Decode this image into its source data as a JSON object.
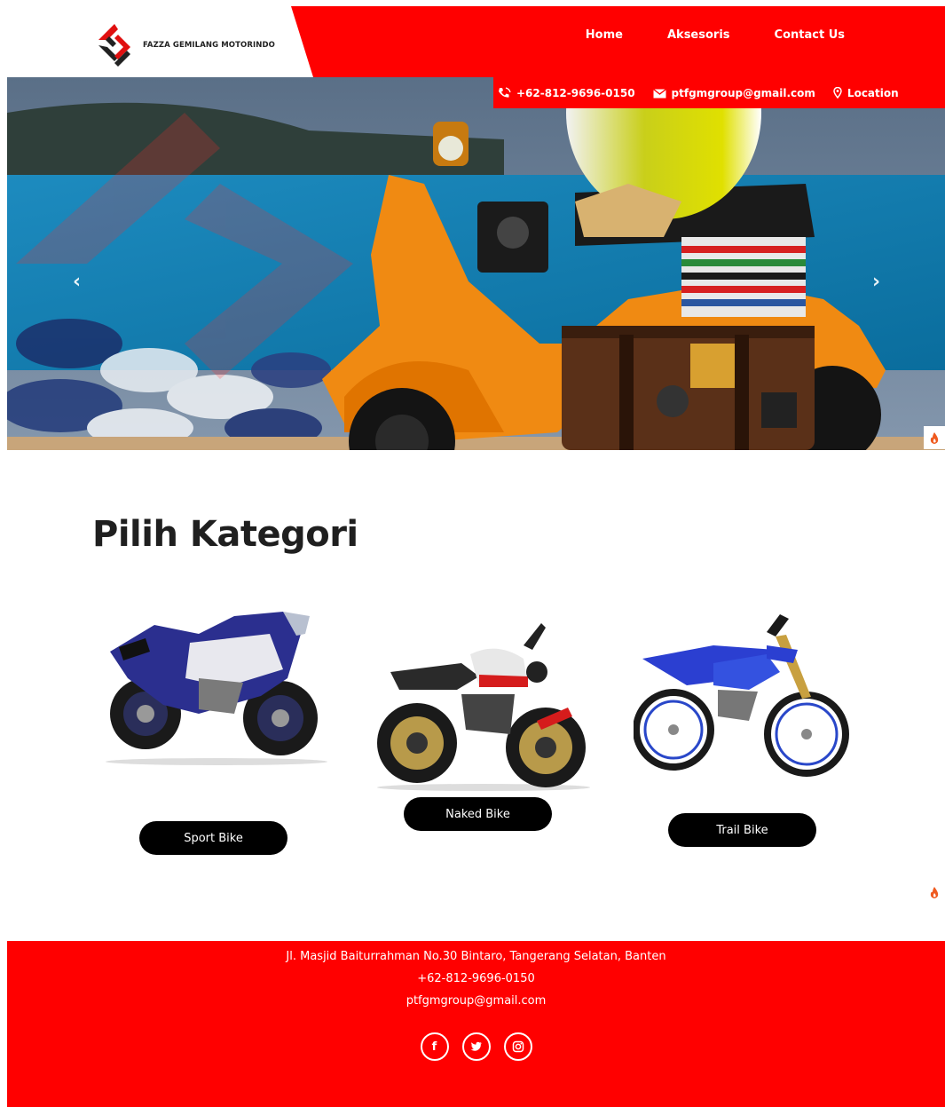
{
  "brand": {
    "name": "FAZZA GEMILANG MOTORINDO",
    "colors": {
      "primary": "#ff0000",
      "dark": "#000000"
    }
  },
  "nav": {
    "items": [
      "Home",
      "Aksesoris",
      "Contact Us"
    ]
  },
  "contact": {
    "phone": "+62-812-9696-0150",
    "email": "ptfgmgroup@gmail.com",
    "location": "Location",
    "icons": [
      "phone-icon",
      "mail-icon",
      "location-pin-icon"
    ]
  },
  "hero": {
    "controls": {
      "prev": "‹",
      "next": "›"
    }
  },
  "categories": {
    "title": "Pilih Kategori",
    "items": [
      {
        "label": "Sport Bike",
        "image": "sport-bike-image"
      },
      {
        "label": "Naked Bike",
        "image": "naked-bike-image"
      },
      {
        "label": "Trail Bike",
        "image": "trail-bike-image"
      }
    ]
  },
  "footer": {
    "address": "Jl. Masjid Baiturrahman No.30 Bintaro, Tangerang Selatan, Banten",
    "phone": "+62-812-9696-0150",
    "email": "ptfgmgroup@gmail.com",
    "socials": [
      {
        "name": "facebook-icon",
        "glyph": "f"
      },
      {
        "name": "twitter-icon",
        "glyph": "🐦"
      },
      {
        "name": "instagram-icon",
        "glyph": "◎"
      }
    ]
  }
}
